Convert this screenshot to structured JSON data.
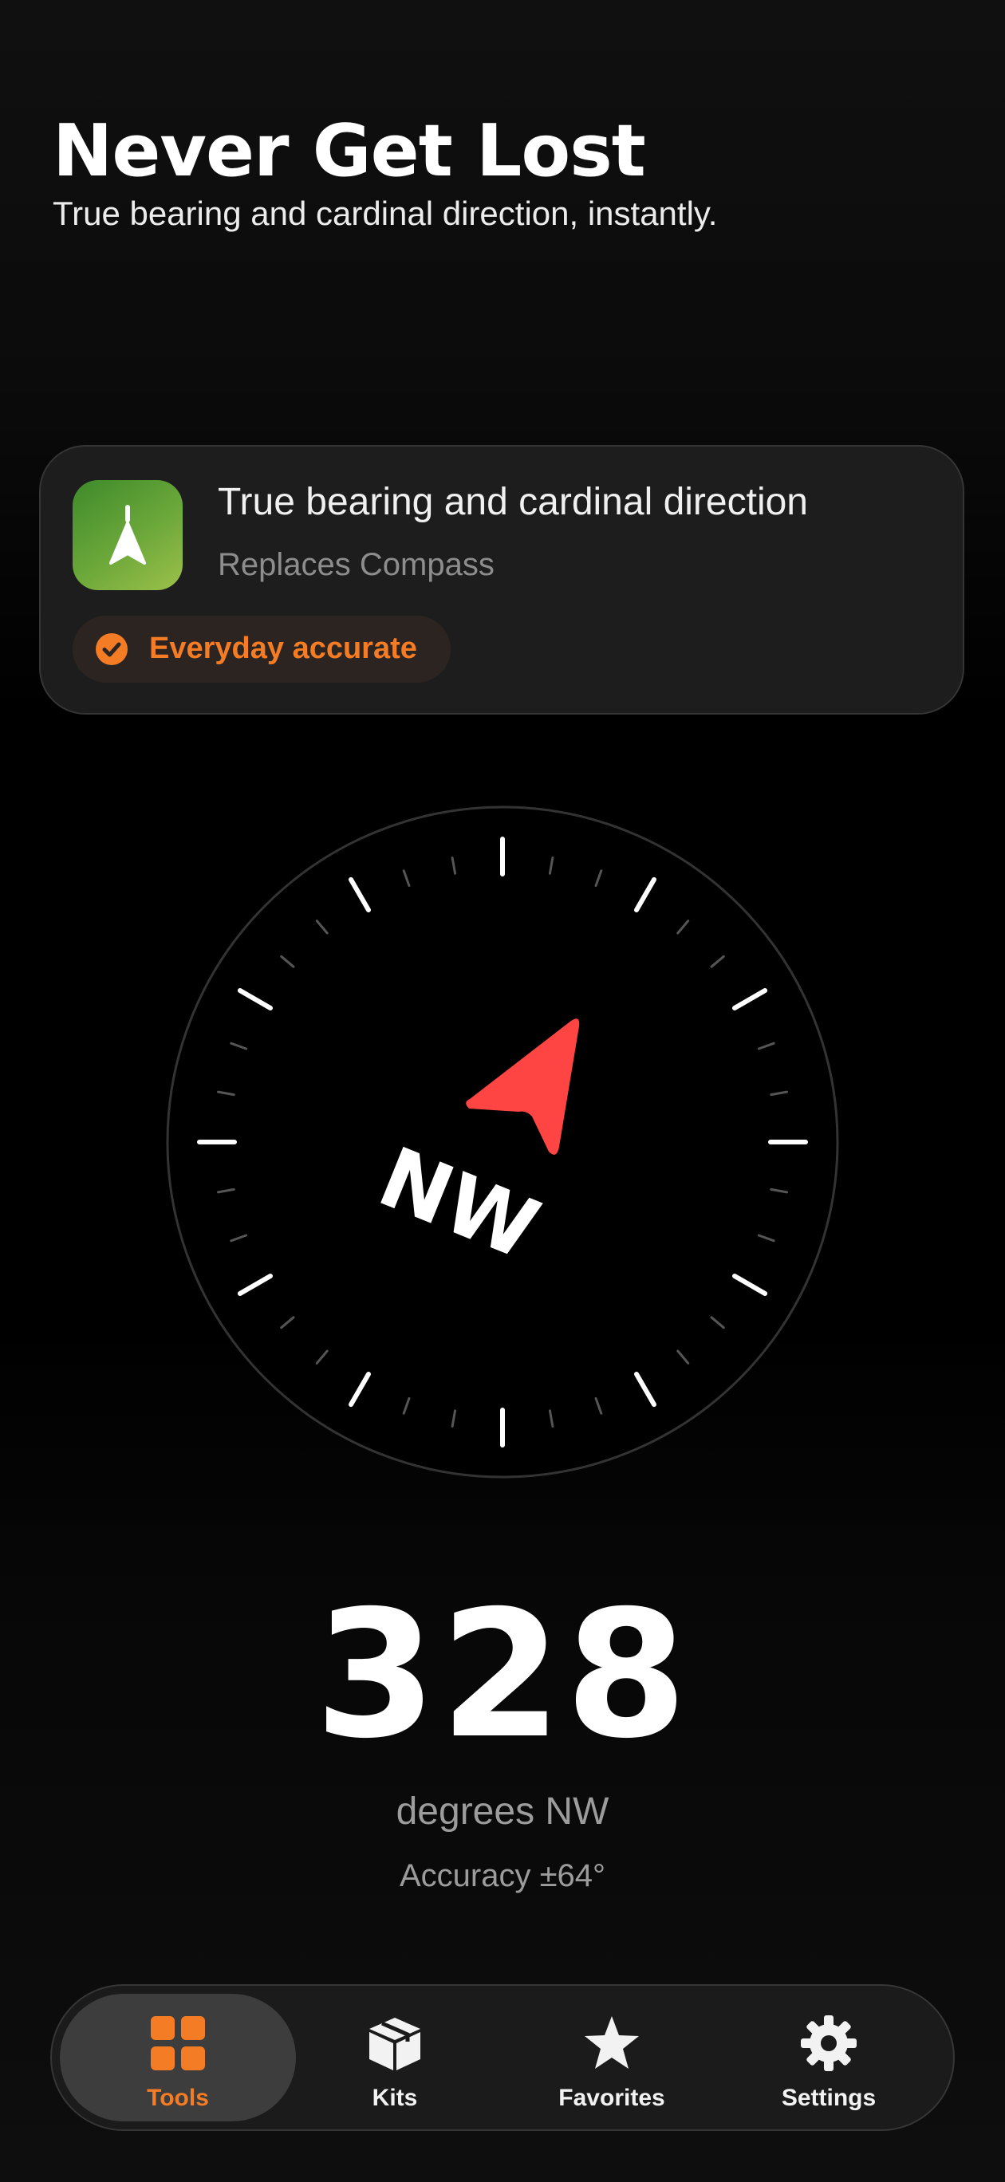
{
  "header": {
    "title": "Never Get Lost",
    "subtitle": "True bearing and cardinal direction, instantly."
  },
  "feature_card": {
    "icon": "compass-arrow-icon",
    "title": "True bearing and cardinal direction",
    "subtitle": "Replaces Compass",
    "badge": {
      "icon": "checkmark-circle-icon",
      "label": "Everyday accurate"
    }
  },
  "compass": {
    "heading_degrees": 328,
    "cardinal": "NW",
    "needle_color": "#ff4444"
  },
  "reading": {
    "value": "328",
    "unit_label": "degrees NW",
    "accuracy": "Accuracy ±64°"
  },
  "tab_bar": {
    "tabs": [
      {
        "label": "Tools",
        "icon": "grid-icon",
        "active": true
      },
      {
        "label": "Kits",
        "icon": "box-icon",
        "active": false
      },
      {
        "label": "Favorites",
        "icon": "star-icon",
        "active": false
      },
      {
        "label": "Settings",
        "icon": "gear-icon",
        "active": false
      }
    ]
  },
  "colors": {
    "accent": "#f47c24",
    "needle": "#ff4444",
    "background": "#000000"
  }
}
